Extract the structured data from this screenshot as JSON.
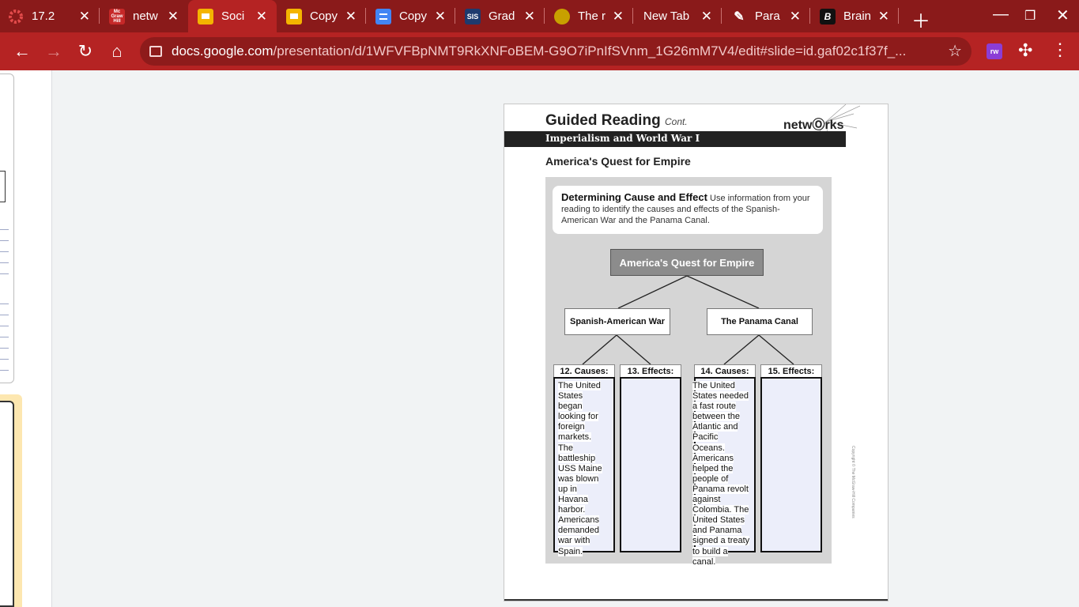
{
  "tabs": [
    {
      "title": "17.2",
      "favicon": "ring-icon",
      "color": "#e34b4b"
    },
    {
      "title": "netw",
      "favicon": "mcgraw-hill-icon",
      "color": "#c62828"
    },
    {
      "title": "Soci",
      "favicon": "slides-icon",
      "color": "#f4b400",
      "active": true
    },
    {
      "title": "Copy",
      "favicon": "slides-icon",
      "color": "#f4b400"
    },
    {
      "title": "Copy",
      "favicon": "docs-icon",
      "color": "#4285f4"
    },
    {
      "title": "Grad",
      "favicon": "sis-icon",
      "color": "#1e3a6e"
    },
    {
      "title": "The r",
      "favicon": "profile-icon",
      "color": "#c8a000"
    },
    {
      "title": "New Tab",
      "favicon": "",
      "color": ""
    },
    {
      "title": "Para",
      "favicon": "pencil-icon",
      "color": ""
    },
    {
      "title": "Brain",
      "favicon": "brainly-icon",
      "color": "#111111"
    }
  ],
  "favicon_text": {
    "mcgraw": "Mc Graw Hill",
    "sis": "SIS",
    "brainly": "B"
  },
  "address_bar": {
    "host": "docs.google.com",
    "path": "/presentation/d/1WFVFBpNMT9RkXNFoBEM-G9O7iPnIfSVnm_1G26mM7V4/edit#slide=id.gaf02c1f37f_..."
  },
  "extension_label": "rw",
  "colors": {
    "chrome_accent": "#b52323",
    "chrome_dark": "#8a1a1a"
  },
  "slide": {
    "title": "Guided Reading",
    "title_suffix": "Cont.",
    "brand": "netwⓄrks",
    "unit": "Imperialism and World War I",
    "lesson": "America's Quest for Empire",
    "instructions_bold": "Determining Cause and Effect",
    "instructions_text": "Use information from your reading to identify the causes and effects of the Spanish-American War and the Panama Canal.",
    "diagram": {
      "root": "America's Quest for Empire",
      "left": "Spanish-American War",
      "right": "The Panama Canal",
      "columns": [
        {
          "label": "12. Causes:",
          "text": "The United States began looking for foreign markets. The battleship USS Maine was blown up in Havana harbor. Americans demanded war with Spain."
        },
        {
          "label": "13. Effects:",
          "text": ""
        },
        {
          "label": "14. Causes:",
          "text": "The United States needed a fast route between the Atlantic and Pacific Oceans. Americans helped the people of Panama revolt against Colombia. The United States and Panama signed a treaty to build a canal."
        },
        {
          "label": "15. Effects:",
          "text": ""
        }
      ]
    },
    "copyright": "Copyright © The McGraw-Hill Companies"
  }
}
